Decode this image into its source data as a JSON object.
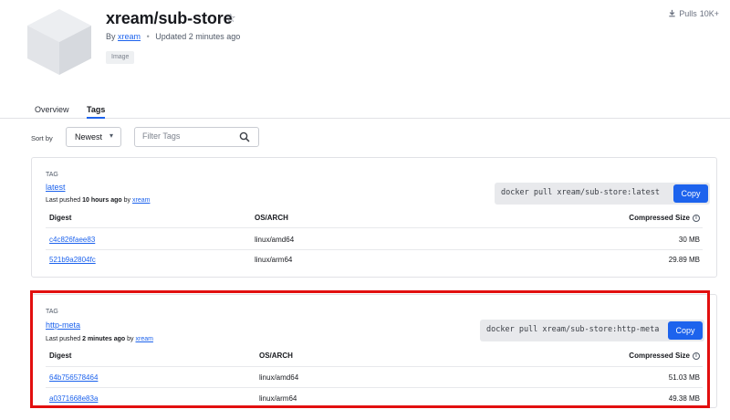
{
  "repo": {
    "title": "xream/sub-store",
    "by_label": "By",
    "owner": "xream",
    "updated": "Updated 2 minutes ago",
    "type_badge": "Image",
    "pulls_label": "Pulls",
    "pulls_count": "10K+"
  },
  "tabs": [
    {
      "label": "Overview",
      "active": false
    },
    {
      "label": "Tags",
      "active": true
    }
  ],
  "toolbar": {
    "sort_label": "Sort by",
    "sort_value": "Newest",
    "filter_placeholder": "Filter Tags"
  },
  "tags": [
    {
      "caption": "TAG",
      "name": "latest",
      "pushed_prefix": "Last pushed",
      "pushed_time": "10 hours ago",
      "pushed_by": "by",
      "pusher": "xream",
      "pull_command": "docker pull xream/sub-store:latest",
      "copy_label": "Copy",
      "columns": [
        "Digest",
        "OS/ARCH",
        "Compressed Size"
      ],
      "rows": [
        {
          "digest": "c4c826faee83",
          "os_arch": "linux/amd64",
          "size": "30 MB"
        },
        {
          "digest": "521b9a2804fc",
          "os_arch": "linux/arm64",
          "size": "29.89 MB"
        }
      ]
    },
    {
      "caption": "TAG",
      "name": "http-meta",
      "pushed_prefix": "Last pushed",
      "pushed_time": "2 minutes ago",
      "pushed_by": "by",
      "pusher": "xream",
      "pull_command": "docker pull xream/sub-store:http-meta",
      "copy_label": "Copy",
      "columns": [
        "Digest",
        "OS/ARCH",
        "Compressed Size"
      ],
      "rows": [
        {
          "digest": "64b756578464",
          "os_arch": "linux/amd64",
          "size": "51.03 MB"
        },
        {
          "digest": "a0371668e83a",
          "os_arch": "linux/arm64",
          "size": "49.38 MB"
        }
      ]
    }
  ],
  "colors": {
    "accent": "#1d63ed",
    "highlight": "#e20f0f"
  },
  "icons": {
    "star": "star-outline-icon",
    "pulls": "download-icon",
    "search": "search-icon",
    "sort": "chevron-down-icon",
    "info": "info-icon"
  }
}
